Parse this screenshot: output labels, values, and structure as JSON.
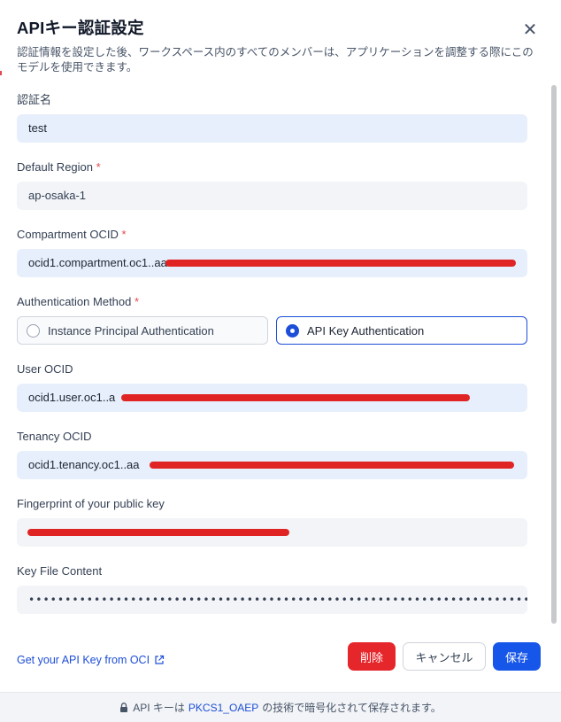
{
  "dialog": {
    "title": "APIキー認証設定",
    "subtitle": "認証情報を設定した後、ワークスペース内のすべてのメンバーは、アプリケーションを調整する際にこのモデルを使用できます。",
    "close_icon": "close-icon"
  },
  "fields": {
    "auth_name": {
      "label": "認証名",
      "value": "test"
    },
    "default_region": {
      "label": "Default Region",
      "required": "*",
      "value": "ap-osaka-1"
    },
    "compartment_ocid": {
      "label": "Compartment OCID",
      "required": "*",
      "value": "ocid1.compartment.oc1..aa"
    },
    "auth_method": {
      "label": "Authentication Method",
      "required": "*",
      "options": [
        {
          "label": "Instance Principal Authentication",
          "selected": false
        },
        {
          "label": "API Key Authentication",
          "selected": true
        }
      ]
    },
    "user_ocid": {
      "label": "User OCID",
      "value": "ocid1.user.oc1..a"
    },
    "tenancy_ocid": {
      "label": "Tenancy OCID",
      "value": "ocid1.tenancy.oc1..aa"
    },
    "fingerprint": {
      "label": "Fingerprint of your public key",
      "value": ""
    },
    "key_file": {
      "label": "Key File Content",
      "value": "•••••••••••••••••••••••••••••••••••••••••••••••••••••••••••••••••••••••••••••••••"
    }
  },
  "footer": {
    "api_key_link": "Get your API Key from OCI",
    "link_icon": "external-link-icon",
    "delete_label": "削除",
    "cancel_label": "キャンセル",
    "save_label": "保存"
  },
  "security_note": {
    "prefix": "API キーは",
    "highlight": "PKCS1_OAEP",
    "suffix": "の技術で暗号化されて保存されます。"
  },
  "colors": {
    "primary": "#1656e8",
    "danger": "#e5262b",
    "input_blue": "#e8effc",
    "input_grey": "#f2f4f7",
    "redaction": "#e02424"
  }
}
